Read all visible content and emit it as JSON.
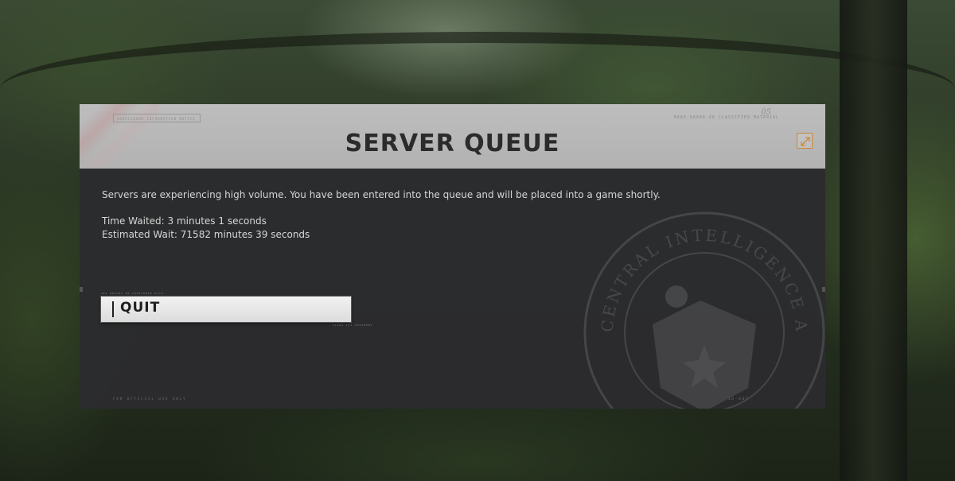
{
  "dialog": {
    "title": "SERVER QUEUE",
    "header_tag": "SOURCEBOOK INFORMATION NOTICE",
    "header_ref_mark": "05",
    "header_ref": "0000-00000-00 CLASSIFIED MATERIAL",
    "expand_icon": "expand-icon",
    "message": "Servers are experiencing high volume. You have been entered into the queue and will be placed into a game shortly.",
    "time_waited": "Time Waited: 3 minutes 1 seconds",
    "estimated_wait": "Estimated Wait: 71582 minutes 39 seconds",
    "quit_label": "QUIT",
    "quit_meta_top": "SEE REPORT NO CONFIRMED DATA",
    "quit_meta_bottom": "CLASS III DOCUMENT",
    "footer_left": "FOR OFFICIAL USE ONLY",
    "footer_right": "ID-007",
    "emblem_text": "CENTRAL INTELLIGENCE AGENCY"
  },
  "colors": {
    "header_bg": "#b8b8b8",
    "panel_bg": "#2c2c2e",
    "title": "#2b2b2b",
    "body_text": "#d6d6d6",
    "accent": "#c98a3a",
    "button_bg": "#eeeeee"
  }
}
